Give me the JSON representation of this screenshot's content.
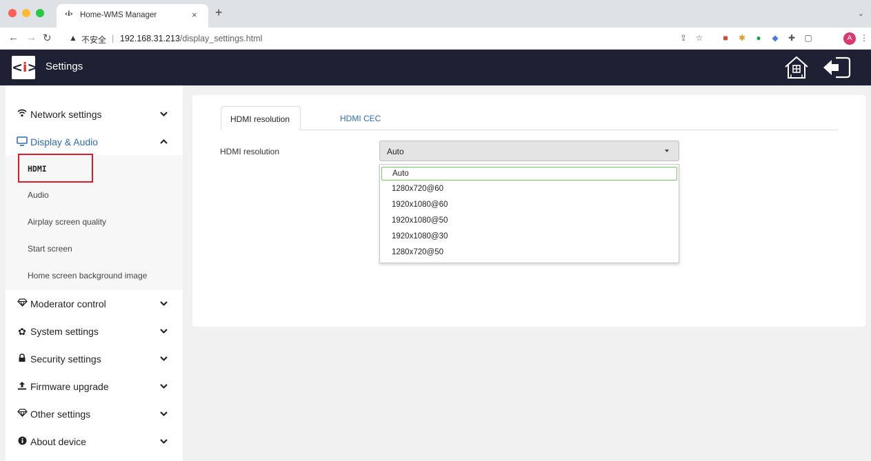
{
  "browser": {
    "tab_title": "Home-WMS Manager",
    "tab_favicon": "‹i›",
    "tab_close": "×",
    "new_tab": "+",
    "url_warning": "不安全",
    "url_host": "192.168.31.213",
    "url_path": "/display_settings.html",
    "avatar_letter": "A"
  },
  "app": {
    "title": "Settings",
    "logo_left": "<",
    "logo_mid": "i",
    "logo_right": ">"
  },
  "sidebar": {
    "items": [
      {
        "label": "Network settings",
        "icon": "wifi-icon",
        "expanded": false
      },
      {
        "label": "Display & Audio",
        "icon": "monitor-icon",
        "expanded": true
      },
      {
        "label": "Moderator control",
        "icon": "diamond-icon",
        "expanded": false
      },
      {
        "label": "System settings",
        "icon": "gear-icon",
        "expanded": false
      },
      {
        "label": "Security settings",
        "icon": "lock-icon",
        "expanded": false
      },
      {
        "label": "Firmware upgrade",
        "icon": "upload-icon",
        "expanded": false
      },
      {
        "label": "Other settings",
        "icon": "diamond-icon",
        "expanded": false
      },
      {
        "label": "About device",
        "icon": "info-icon",
        "expanded": false
      }
    ],
    "subitems": [
      {
        "label": "HDMI",
        "current": true
      },
      {
        "label": "Audio"
      },
      {
        "label": "Airplay screen quality"
      },
      {
        "label": "Start screen"
      },
      {
        "label": "Home screen background image"
      }
    ]
  },
  "main": {
    "tabs": [
      {
        "label": "HDMI resolution",
        "active": true
      },
      {
        "label": "HDMI CEC",
        "active": false
      }
    ],
    "field_label": "HDMI resolution",
    "select_value": "Auto",
    "options": [
      "Auto",
      "1280x720@60",
      "1920x1080@60",
      "1920x1080@50",
      "1920x1080@30",
      "1280x720@50"
    ]
  },
  "colors": {
    "header_bg": "#1e2133",
    "accent": "#2b6cb0",
    "highlight_red": "#d81c2a",
    "selected_option_border": "#7cc26b"
  }
}
